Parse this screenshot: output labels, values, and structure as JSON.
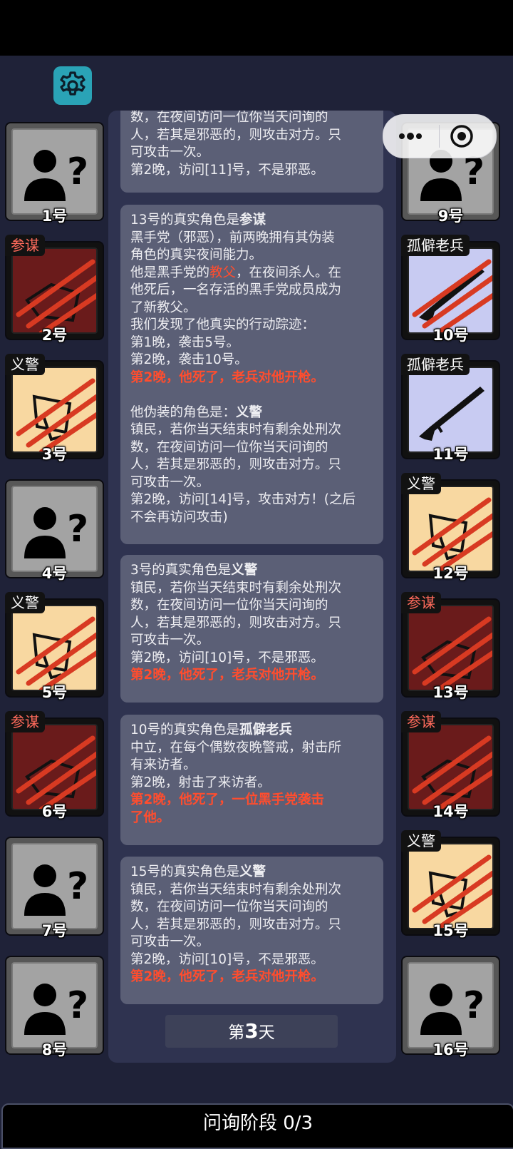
{
  "settings_label": "",
  "players": [
    {
      "num": "1号",
      "tag": "",
      "state": "unknown"
    },
    {
      "num": "2号",
      "tag": "参谋",
      "state": "strat"
    },
    {
      "num": "3号",
      "tag": "义警",
      "state": "vig"
    },
    {
      "num": "4号",
      "tag": "",
      "state": "unknown"
    },
    {
      "num": "5号",
      "tag": "义警",
      "state": "vig"
    },
    {
      "num": "6号",
      "tag": "参谋",
      "state": "strat"
    },
    {
      "num": "7号",
      "tag": "",
      "state": "unknown"
    },
    {
      "num": "8号",
      "tag": "",
      "state": "unknown"
    },
    {
      "num": "9号",
      "tag": "",
      "state": "unknown"
    },
    {
      "num": "10号",
      "tag": "孤僻老兵",
      "state": "vet_dead"
    },
    {
      "num": "11号",
      "tag": "孤僻老兵",
      "state": "vet"
    },
    {
      "num": "12号",
      "tag": "义警",
      "state": "vig"
    },
    {
      "num": "13号",
      "tag": "参谋",
      "state": "strat"
    },
    {
      "num": "14号",
      "tag": "参谋",
      "state": "strat"
    },
    {
      "num": "15号",
      "tag": "义警",
      "state": "vig"
    },
    {
      "num": "16号",
      "tag": "",
      "state": "unknown"
    }
  ],
  "log": {
    "msg0": {
      "l1": "数，在夜间访问一位你当天问询的",
      "l2": "人，若其是邪恶的，则攻击对方。只",
      "l3": "可攻击一次。",
      "l4": "第2晚，访问[11]号，不是邪恶。"
    },
    "msg1": {
      "title_pre": "13号的真实角色是",
      "title_role": "参谋",
      "l1": "黑手党（邪恶），前两晚拥有其伪装",
      "l2": "角色的真实夜间能力。",
      "l3_pre": "他是黑手党的",
      "l3_role": "教父",
      "l3_post": "，在夜间杀人。在",
      "l4": "他死后，一名存活的黑手党成员成为",
      "l5": "了新教父。",
      "l6": "我们发现了他真实的行动踪迹：",
      "l7": "第1晚，袭击5号。",
      "l8": "第2晚，袭击10号。",
      "death": "第2晚，他死了，老兵对他开枪。",
      "disguise_pre": "他伪装的角色是：",
      "disguise_role": "义警",
      "d1": "镇民，若你当天结束时有剩余处刑次",
      "d2": "数，在夜间访问一位你当天问询的",
      "d3": "人，若其是邪恶的，则攻击对方。只",
      "d4": "可攻击一次。",
      "d5": "第2晚，访问[14]号，攻击对方！(之后",
      "d6": "不会再访问攻击)"
    },
    "msg2": {
      "title_pre": "3号的真实角色是",
      "title_role": "义警",
      "l1": "镇民，若你当天结束时有剩余处刑次",
      "l2": "数，在夜间访问一位你当天问询的",
      "l3": "人，若其是邪恶的，则攻击对方。只",
      "l4": "可攻击一次。",
      "l5": "第2晚，访问[10]号，不是邪恶。",
      "death": "第2晚，他死了，老兵对他开枪。"
    },
    "msg3": {
      "title_pre": "10号的真实角色是",
      "title_role": "孤僻老兵",
      "l1": "中立，在每个偶数夜晚警戒，射击所",
      "l2": "有来访者。",
      "l3": "第2晚，射击了来访者。",
      "death1": "第2晚，他死了，一位黑手党袭击",
      "death2": "了他。"
    },
    "msg4": {
      "title_pre": "15号的真实角色是",
      "title_role": "义警",
      "l1": "镇民，若你当天结束时有剩余处刑次",
      "l2": "数，在夜间访问一位你当天问询的",
      "l3": "人，若其是邪恶的，则攻击对方。只",
      "l4": "可攻击一次。",
      "l5": "第2晚，访问[10]号，不是邪恶。",
      "death": "第2晚，他死了，老兵对他开枪。"
    }
  },
  "day": {
    "pre": "第",
    "num": "3",
    "post": "天"
  },
  "phase": "问询阶段 0/3",
  "colors": {
    "accent_red": "#ff4d2e",
    "gear_bg": "#2aa3b6",
    "panel": "#2f3350",
    "message": "#5b5f76"
  }
}
